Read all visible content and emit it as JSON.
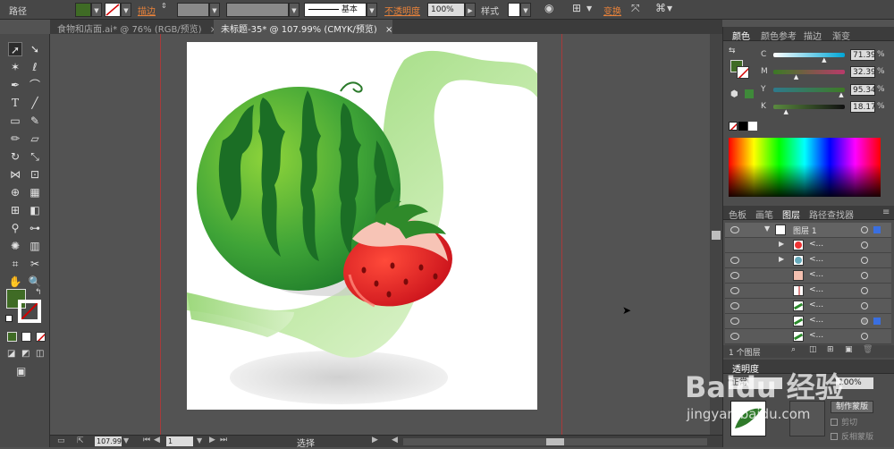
{
  "control_bar": {
    "object_type": "路径",
    "stroke_label": "描边",
    "stroke_style": "基本",
    "opacity_label": "不透明度",
    "opacity_value": "100%",
    "style_label": "样式",
    "transform_label": "变换",
    "fill_color": "#3f6b25"
  },
  "doc_tabs": [
    {
      "title": "食物和店面.ai* @ 76% (RGB/预览)",
      "close": "×"
    },
    {
      "title": "未标题-35* @ 107.99% (CMYK/预览)",
      "close": "×"
    }
  ],
  "color_panel": {
    "tabs": [
      "颜色",
      "颜色参考",
      "描边",
      "渐变"
    ],
    "channels": [
      {
        "label": "C",
        "value": "71.39",
        "percent": 71.39,
        "grad_from": "#ffffff",
        "grad_to": "#00a6d6"
      },
      {
        "label": "M",
        "value": "32.39",
        "percent": 32.39,
        "grad_from": "#3b7a25",
        "grad_to": "#b93a6a"
      },
      {
        "label": "Y",
        "value": "95.34",
        "percent": 95.34,
        "grad_from": "#2e7a8c",
        "grad_to": "#3f7a25"
      },
      {
        "label": "K",
        "value": "18.17",
        "percent": 18.17,
        "grad_from": "#5a8a3f",
        "grad_to": "#101010"
      }
    ]
  },
  "layers_panel": {
    "tabs": [
      "色板",
      "画笔",
      "图层",
      "路径查找器"
    ],
    "top_layer_name": "图层 1",
    "sublayer_label": "<...",
    "footer_count": "1 个图层"
  },
  "transparency_panel": {
    "title": "透明度",
    "mode": "正常",
    "opacity": "100%",
    "make_mask_button": "制作蒙版",
    "clip_label": "剪切",
    "invert_mask_label": "反相蒙版"
  },
  "status_bar": {
    "zoom": "107.99",
    "page": "1",
    "tool_status": "选择"
  },
  "watermark": {
    "logo": "Baidu 经验",
    "url": "jingyan.baidu.com"
  }
}
